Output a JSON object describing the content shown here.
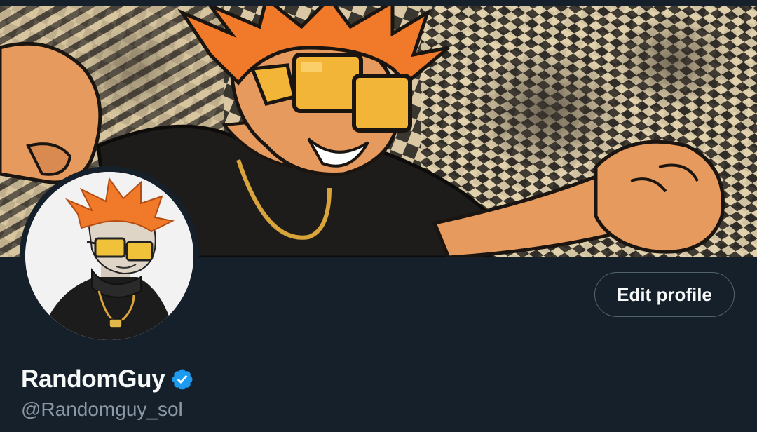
{
  "profile": {
    "display_name": "RandomGuy",
    "handle": "@Randomguy_sol",
    "verified": true,
    "edit_button_label": "Edit profile"
  },
  "icons": {
    "verified": "verified-badge-icon"
  },
  "colors": {
    "background": "#15202b",
    "text_primary": "#f7f9f9",
    "text_secondary": "#8b98a5",
    "verified_blue": "#1d9bf0",
    "button_border": "#536471",
    "hair_orange": "#f07a2a",
    "glasses_gold": "#f2b538"
  }
}
